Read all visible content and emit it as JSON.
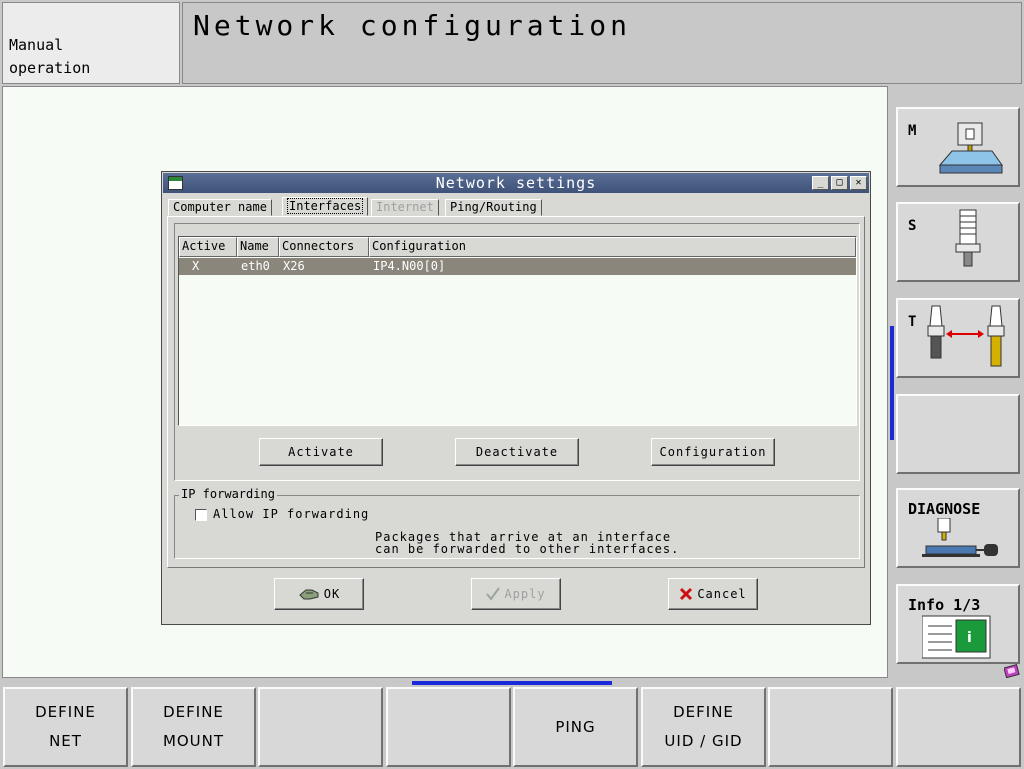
{
  "header": {
    "mode": "Manual\noperation",
    "title": "Network configuration"
  },
  "dialog": {
    "title": "Network settings",
    "window_buttons": {
      "minimize": "_",
      "maximize": "□",
      "close": "✕"
    },
    "tabs": [
      {
        "label": "Computer name",
        "state": "normal"
      },
      {
        "label": "Interfaces",
        "state": "active"
      },
      {
        "label": "Internet",
        "state": "disabled"
      },
      {
        "label": "Ping/Routing",
        "state": "normal"
      }
    ],
    "table": {
      "columns": [
        "Active",
        "Name",
        "Connectors",
        "Configuration"
      ],
      "rows": [
        {
          "active": "X",
          "name": "eth0",
          "connectors": "X26",
          "configuration": "IP4.N00[0]"
        }
      ]
    },
    "interface_buttons": {
      "activate": "Activate",
      "deactivate": "Deactivate",
      "configuration": "Configuration"
    },
    "ip_forwarding": {
      "group_label": "IP forwarding",
      "checkbox_label": "Allow IP forwarding",
      "checked": false,
      "description": "Packages that arrive at an interface\ncan be forwarded to other interfaces."
    },
    "buttons": {
      "ok": "OK",
      "apply": "Apply",
      "cancel": "Cancel"
    }
  },
  "right_softkeys": [
    {
      "label": "M"
    },
    {
      "label": "S"
    },
    {
      "label": "T"
    },
    {
      "label": ""
    },
    {
      "label": "DIAGNOSE"
    },
    {
      "label": "Info 1/3"
    }
  ],
  "bottom_softkeys": [
    {
      "line1": "DEFINE",
      "line2": "NET"
    },
    {
      "line1": "DEFINE",
      "line2": "MOUNT"
    },
    {
      "line1": "",
      "line2": ""
    },
    {
      "line1": "",
      "line2": ""
    },
    {
      "line1": "PING",
      "line2": ""
    },
    {
      "line1": "DEFINE",
      "line2": "UID / GID"
    },
    {
      "line1": "",
      "line2": ""
    },
    {
      "line1": "",
      "line2": ""
    }
  ],
  "colors": {
    "titlebar": "#3f5279",
    "selected_row": "#8a867c",
    "indicator": "#1a2ad8",
    "info_green": "#1a9a3a"
  }
}
